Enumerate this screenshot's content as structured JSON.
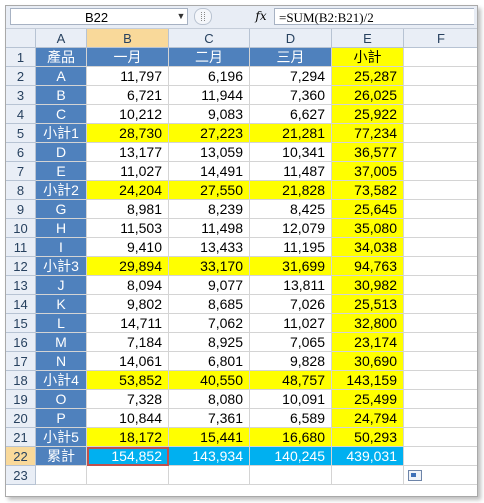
{
  "formula_bar": {
    "name_box": "B22",
    "fx_label": "fx",
    "formula": "=SUM(B2:B21)/2"
  },
  "columns": [
    "A",
    "B",
    "C",
    "D",
    "E",
    "F"
  ],
  "header_row": [
    "產品",
    "一月",
    "二月",
    "三月",
    "小計"
  ],
  "rows": [
    {
      "n": "2",
      "label": "A",
      "b": "11,797",
      "c": "6,196",
      "d": "7,294",
      "e": "25,287",
      "sub": false
    },
    {
      "n": "3",
      "label": "B",
      "b": "6,721",
      "c": "11,944",
      "d": "7,360",
      "e": "26,025",
      "sub": false
    },
    {
      "n": "4",
      "label": "C",
      "b": "10,212",
      "c": "9,083",
      "d": "6,627",
      "e": "25,922",
      "sub": false
    },
    {
      "n": "5",
      "label": "小計1",
      "b": "28,730",
      "c": "27,223",
      "d": "21,281",
      "e": "77,234",
      "sub": true
    },
    {
      "n": "6",
      "label": "D",
      "b": "13,177",
      "c": "13,059",
      "d": "10,341",
      "e": "36,577",
      "sub": false
    },
    {
      "n": "7",
      "label": "E",
      "b": "11,027",
      "c": "14,491",
      "d": "11,487",
      "e": "37,005",
      "sub": false
    },
    {
      "n": "8",
      "label": "小計2",
      "b": "24,204",
      "c": "27,550",
      "d": "21,828",
      "e": "73,582",
      "sub": true
    },
    {
      "n": "9",
      "label": "G",
      "b": "8,981",
      "c": "8,239",
      "d": "8,425",
      "e": "25,645",
      "sub": false
    },
    {
      "n": "10",
      "label": "H",
      "b": "11,503",
      "c": "11,498",
      "d": "12,079",
      "e": "35,080",
      "sub": false
    },
    {
      "n": "11",
      "label": "I",
      "b": "9,410",
      "c": "13,433",
      "d": "11,195",
      "e": "34,038",
      "sub": false
    },
    {
      "n": "12",
      "label": "小計3",
      "b": "29,894",
      "c": "33,170",
      "d": "31,699",
      "e": "94,763",
      "sub": true
    },
    {
      "n": "13",
      "label": "J",
      "b": "8,094",
      "c": "9,077",
      "d": "13,811",
      "e": "30,982",
      "sub": false
    },
    {
      "n": "14",
      "label": "K",
      "b": "9,802",
      "c": "8,685",
      "d": "7,026",
      "e": "25,513",
      "sub": false
    },
    {
      "n": "15",
      "label": "L",
      "b": "14,711",
      "c": "7,062",
      "d": "11,027",
      "e": "32,800",
      "sub": false
    },
    {
      "n": "16",
      "label": "M",
      "b": "7,184",
      "c": "8,925",
      "d": "7,065",
      "e": "23,174",
      "sub": false
    },
    {
      "n": "17",
      "label": "N",
      "b": "14,061",
      "c": "6,801",
      "d": "9,828",
      "e": "30,690",
      "sub": false
    },
    {
      "n": "18",
      "label": "小計4",
      "b": "53,852",
      "c": "40,550",
      "d": "48,757",
      "e": "143,159",
      "sub": true
    },
    {
      "n": "19",
      "label": "O",
      "b": "7,328",
      "c": "8,080",
      "d": "10,091",
      "e": "25,499",
      "sub": false
    },
    {
      "n": "20",
      "label": "P",
      "b": "10,844",
      "c": "7,361",
      "d": "6,589",
      "e": "24,794",
      "sub": false
    },
    {
      "n": "21",
      "label": "小計5",
      "b": "18,172",
      "c": "15,441",
      "d": "16,680",
      "e": "50,293",
      "sub": true
    }
  ],
  "total_row": {
    "n": "22",
    "label": "累計",
    "b": "154,852",
    "c": "143,934",
    "d": "140,245",
    "e": "439,031"
  },
  "empty_row": {
    "n": "23"
  },
  "colors": {
    "label_blue": "#4f81bd",
    "subtotal_yellow": "#ffff00",
    "total_cyan": "#00b0f0",
    "selected_header": "#f9d99a"
  }
}
